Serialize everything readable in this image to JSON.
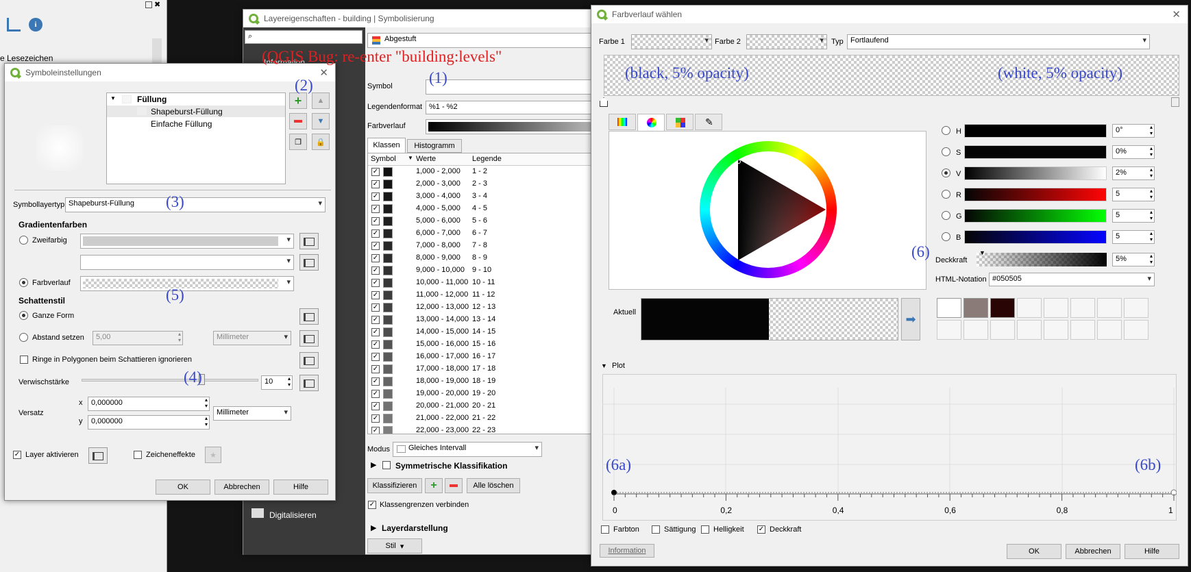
{
  "colors": {
    "accent": "#3949c9",
    "warning": "#e02020",
    "qgis_green": "#72b03c"
  },
  "bookmarks": {
    "label": "e Lesezeichen"
  },
  "layer_props": {
    "title": "Layereigenschaften - building | Symbolisierung",
    "renderer": "Abgestuft",
    "info_tab": "Information",
    "symbol_label": "Symbol",
    "legend_format_label": "Legendenformat",
    "legend_format_value": "%1 - %2",
    "ramp_label": "Farbverlauf",
    "tabs": [
      "Klassen",
      "Histogramm"
    ],
    "table_headers": [
      "Symbol",
      "Werte",
      "Legende"
    ],
    "rows": [
      {
        "v": "1,000 - 2,000",
        "l": "1 - 2",
        "c": "#111111"
      },
      {
        "v": "2,000 - 3,000",
        "l": "2 - 3",
        "c": "#141414"
      },
      {
        "v": "3,000 - 4,000",
        "l": "3 - 4",
        "c": "#181818"
      },
      {
        "v": "4,000 - 5,000",
        "l": "4 - 5",
        "c": "#1c1c1c"
      },
      {
        "v": "5,000 - 6,000",
        "l": "5 - 6",
        "c": "#202020"
      },
      {
        "v": "6,000 - 7,000",
        "l": "6 - 7",
        "c": "#242424"
      },
      {
        "v": "7,000 - 8,000",
        "l": "7 - 8",
        "c": "#282828"
      },
      {
        "v": "8,000 - 9,000",
        "l": "8 - 9",
        "c": "#2d2d2d"
      },
      {
        "v": "9,000 - 10,000",
        "l": "9 - 10",
        "c": "#323232"
      },
      {
        "v": "10,000 - 11,000",
        "l": "10 - 11",
        "c": "#373737"
      },
      {
        "v": "11,000 - 12,000",
        "l": "11 - 12",
        "c": "#3c3c3c"
      },
      {
        "v": "12,000 - 13,000",
        "l": "12 - 13",
        "c": "#414141"
      },
      {
        "v": "13,000 - 14,000",
        "l": "13 - 14",
        "c": "#474747"
      },
      {
        "v": "14,000 - 15,000",
        "l": "14 - 15",
        "c": "#4d4d4d"
      },
      {
        "v": "15,000 - 16,000",
        "l": "15 - 16",
        "c": "#535353"
      },
      {
        "v": "16,000 - 17,000",
        "l": "16 - 17",
        "c": "#595959"
      },
      {
        "v": "17,000 - 18,000",
        "l": "17 - 18",
        "c": "#5f5f5f"
      },
      {
        "v": "18,000 - 19,000",
        "l": "18 - 19",
        "c": "#656565"
      },
      {
        "v": "19,000 - 20,000",
        "l": "19 - 20",
        "c": "#6b6b6b"
      },
      {
        "v": "20,000 - 21,000",
        "l": "20 - 21",
        "c": "#717171"
      },
      {
        "v": "21,000 - 22,000",
        "l": "21 - 22",
        "c": "#777777"
      },
      {
        "v": "22,000 - 23,000",
        "l": "22 - 23",
        "c": "#7d7d7d"
      }
    ],
    "mode_label": "Modus",
    "mode_value": "Gleiches Intervall",
    "symmetric": "Symmetrische Klassifikation",
    "classify": "Klassifizieren",
    "delete_all": "Alle löschen",
    "link_bounds": "Klassengrenzen verbinden",
    "layer_render": "Layerdarstellung",
    "style": "Stil",
    "digitize": "Digitalisieren"
  },
  "symbol_settings": {
    "title": "Symboleinstellungen",
    "tree": {
      "root": "Füllung",
      "child1": "Shapeburst-Füllung",
      "child2": "Einfache Füllung"
    },
    "layer_type_label": "Symbollayertyp",
    "layer_type_value": "Shapeburst-Füllung",
    "gradient_colors": "Gradientenfarben",
    "two_color": "Zweifarbig",
    "ramp": "Farbverlauf",
    "shading_style": "Schattenstil",
    "whole_shape": "Ganze Form",
    "set_distance": "Abstand setzen",
    "distance_value": "5,00",
    "distance_unit": "Millimeter",
    "ignore_rings": "Ringe in Polygonen beim Schattieren ignorieren",
    "blur_label": "Verwischstärke",
    "blur_value": "10",
    "blur_fraction": 0.68,
    "offset_label": "Versatz",
    "x_label": "x",
    "x_value": "0,000000",
    "y_label": "y",
    "y_value": "0,000000",
    "offset_unit": "Millimeter",
    "enable_layer": "Layer aktivieren",
    "draw_effects": "Zeicheneffekte",
    "ok": "OK",
    "cancel": "Abbrechen",
    "help": "Hilfe"
  },
  "ramp_dialog": {
    "title": "Farbverlauf wählen",
    "color1_label": "Farbe 1",
    "color2_label": "Farbe 2",
    "type_label": "Typ",
    "type_value": "Fortlaufend",
    "hsv": [
      {
        "label": "H",
        "value": "0°"
      },
      {
        "label": "S",
        "value": "0%"
      },
      {
        "label": "V",
        "value": "2%"
      }
    ],
    "rgb": [
      {
        "label": "R",
        "value": "5"
      },
      {
        "label": "G",
        "value": "5"
      },
      {
        "label": "B",
        "value": "5"
      }
    ],
    "opacity_label": "Deckkraft",
    "opacity_value": "5%",
    "html_label": "HTML-Notation",
    "html_value": "#050505",
    "current_label": "Aktuell",
    "plot_label": "Plot",
    "x_ticks": [
      "0",
      "0,2",
      "0,4",
      "0,6",
      "0,8",
      "1"
    ],
    "plot_checks": [
      "Farbton",
      "Sättigung",
      "Helligkeit",
      "Deckkraft"
    ],
    "swatch_colors": [
      "#ffffff",
      "#8a7a78",
      "#2a0505"
    ],
    "info": "Information",
    "ok": "OK",
    "cancel": "Abbrechen",
    "help": "Hilfe"
  },
  "annotations": {
    "bug": "(QGIS Bug: re-enter \"building:levels\"",
    "a1": "(1)",
    "a2": "(2)",
    "a3": "(3)",
    "a4": "(4)",
    "a5": "(5)",
    "a6": "(6)",
    "a6a": "(6a)",
    "a6b": "(6b)",
    "black": "(black, 5% opacity)",
    "white": "(white, 5% opacity)"
  }
}
